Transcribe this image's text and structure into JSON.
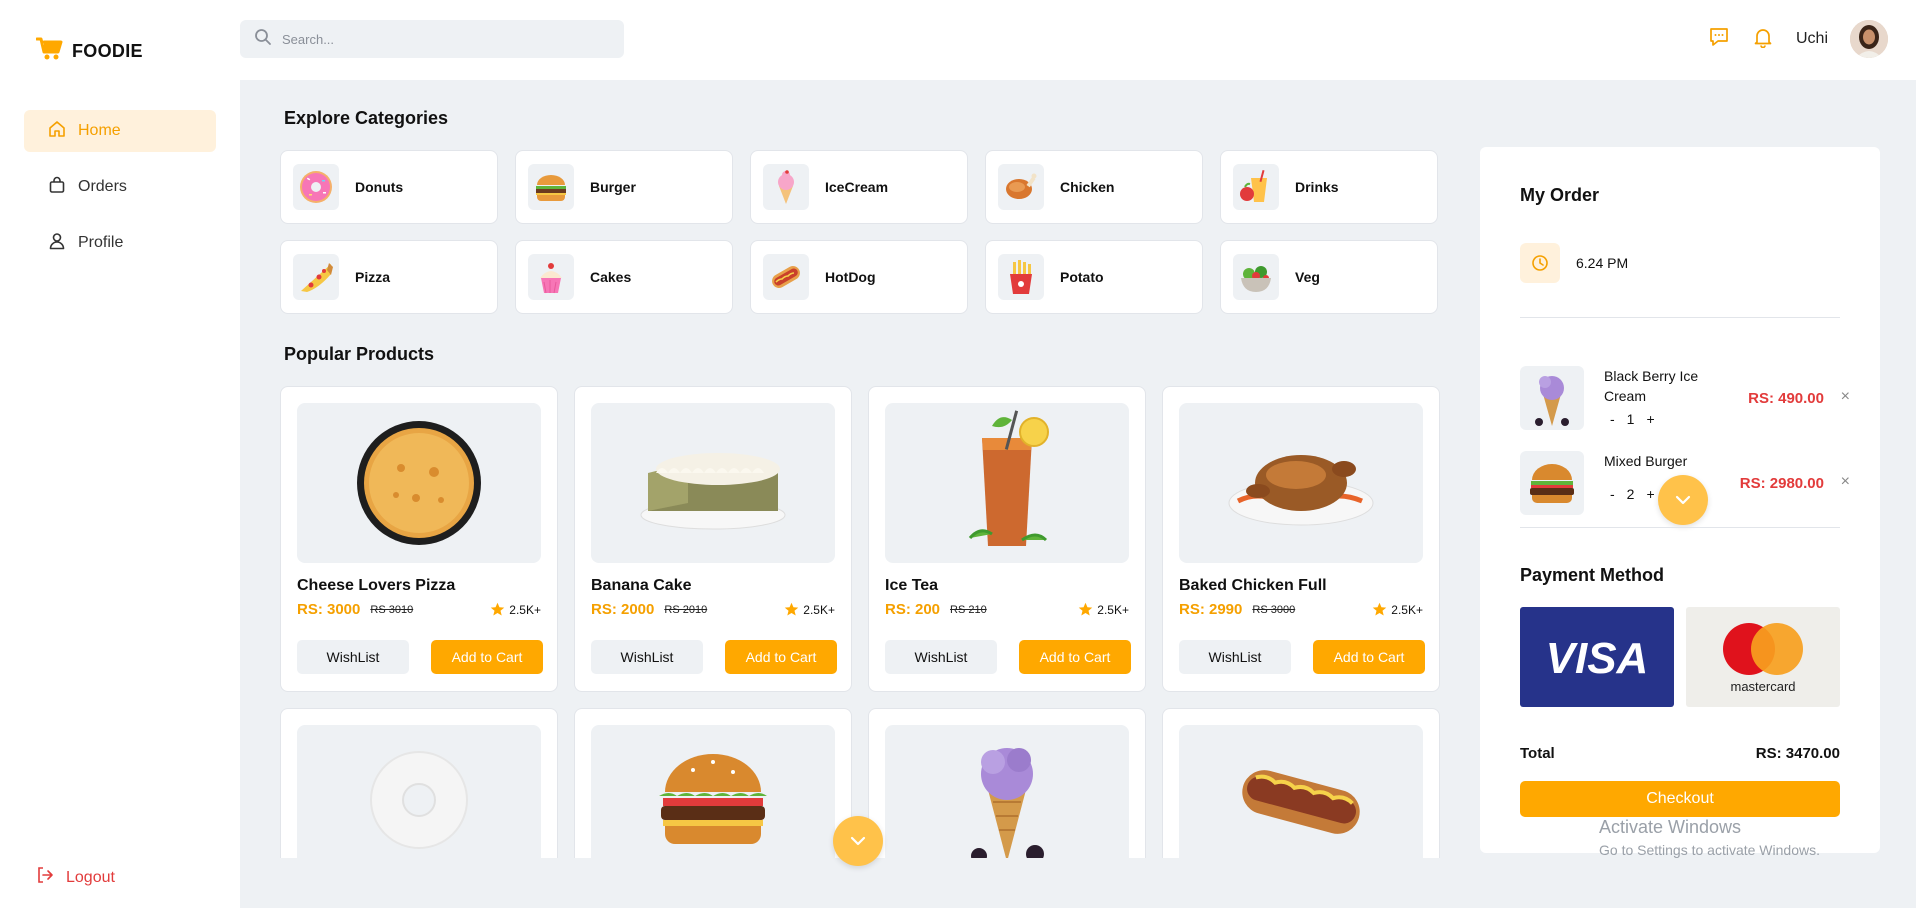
{
  "brand": {
    "name": "FOODIE",
    "accent": "#ffa800"
  },
  "sidebar": {
    "items": [
      {
        "label": "Home",
        "icon": "home-icon",
        "active": true
      },
      {
        "label": "Orders",
        "icon": "bag-icon",
        "active": false
      },
      {
        "label": "Profile",
        "icon": "user-icon",
        "active": false
      }
    ],
    "logout_label": "Logout"
  },
  "header": {
    "search_placeholder": "Search...",
    "user_name": "Uchi"
  },
  "categories_title": "Explore Categories",
  "categories": [
    {
      "label": "Donuts",
      "icon": "donut-icon"
    },
    {
      "label": "Burger",
      "icon": "burger-icon"
    },
    {
      "label": "IceCream",
      "icon": "icecream-icon"
    },
    {
      "label": "Chicken",
      "icon": "chicken-icon"
    },
    {
      "label": "Drinks",
      "icon": "drinks-icon"
    },
    {
      "label": "Pizza",
      "icon": "pizza-icon"
    },
    {
      "label": "Cakes",
      "icon": "cake-icon"
    },
    {
      "label": "HotDog",
      "icon": "hotdog-icon"
    },
    {
      "label": "Potato",
      "icon": "fries-icon"
    },
    {
      "label": "Veg",
      "icon": "salad-icon"
    }
  ],
  "products_title": "Popular Products",
  "products": [
    {
      "name": "Cheese Lovers Pizza",
      "price": "RS: 3000",
      "old_price": "RS 3010",
      "rating": "2.5K+",
      "wishlist_label": "WishList",
      "cart_label": "Add to Cart"
    },
    {
      "name": "Banana Cake",
      "price": "RS: 2000",
      "old_price": "RS 2010",
      "rating": "2.5K+",
      "wishlist_label": "WishList",
      "cart_label": "Add to Cart"
    },
    {
      "name": "Ice Tea",
      "price": "RS: 200",
      "old_price": "RS 210",
      "rating": "2.5K+",
      "wishlist_label": "WishList",
      "cart_label": "Add to Cart"
    },
    {
      "name": "Baked Chicken Full",
      "price": "RS: 2990",
      "old_price": "RS 3000",
      "rating": "2.5K+",
      "wishlist_label": "WishList",
      "cart_label": "Add to Cart"
    }
  ],
  "order": {
    "title": "My Order",
    "time": "6.24 PM",
    "items": [
      {
        "name": "Black Berry Ice Cream",
        "qty": "1",
        "price": "RS: 490.00"
      },
      {
        "name": "Mixed Burger",
        "qty": "2",
        "price": "RS: 2980.00"
      }
    ],
    "minus": "-",
    "plus": "+",
    "remove": "×",
    "payment_title": "Payment Method",
    "visa_label": "VISA",
    "mastercard_label": "mastercard",
    "total_label": "Total",
    "total_value": "RS: 3470.00",
    "checkout_label": "Checkout"
  },
  "watermark": {
    "line1": "Activate Windows",
    "line2": "Go to Settings to activate Windows."
  }
}
